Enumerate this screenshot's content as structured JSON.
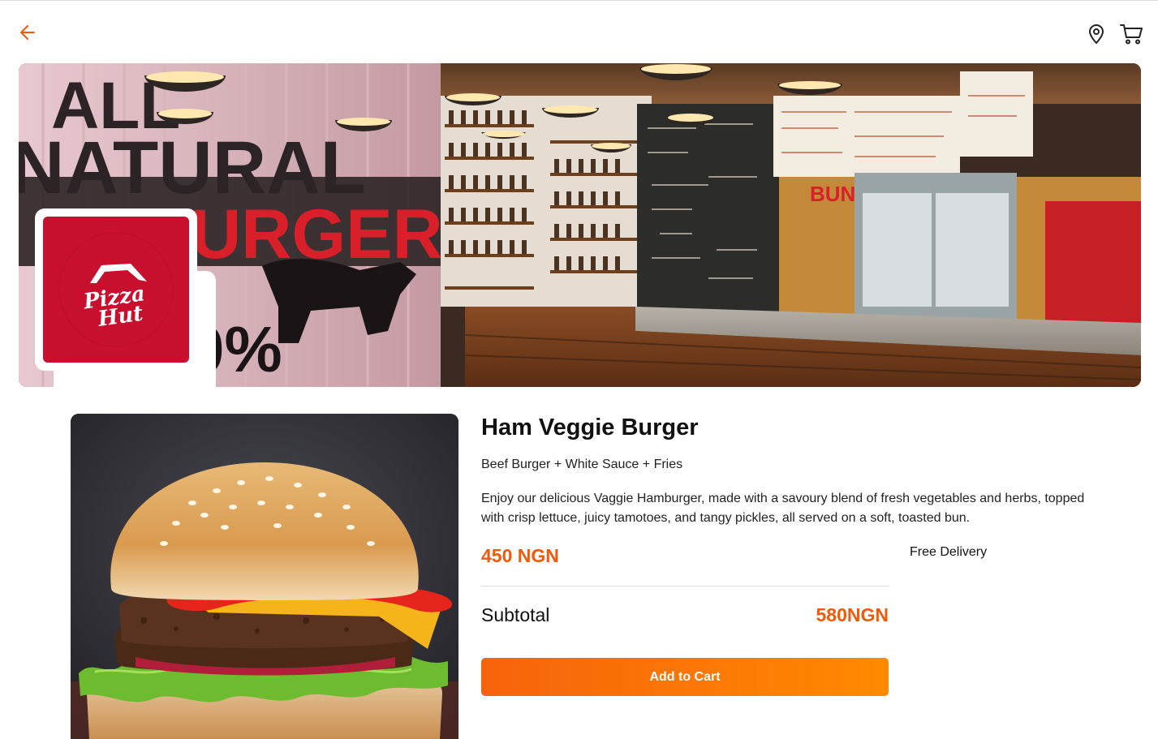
{
  "header": {
    "back_icon": "arrow-left-icon",
    "location_icon": "map-pin-icon",
    "cart_icon": "shopping-cart-icon",
    "accent_color": "#f05a0a"
  },
  "banner": {
    "image": "restaurant-interior-banner",
    "wall_text": [
      "ALL",
      "NATURAL",
      "BURGERS",
      "100%"
    ],
    "sign_text": "BUNS",
    "logo": {
      "brand": "Pizza Hut",
      "line1": "Pizza",
      "line2": "Hut",
      "color": "#c8102e"
    }
  },
  "product": {
    "image": "veggie-burger-photo",
    "title": "Ham Veggie Burger",
    "subtitle": "Beef Burger + White Sauce + Fries",
    "description": "Enjoy our delicious Vaggie Hamburger, made with a savoury blend of fresh vegetables and herbs, topped with crisp lettuce, juicy tamotoes, and tangy pickles, all served on a soft, toasted bun.",
    "price": "450 NGN",
    "delivery": "Free Delivery"
  },
  "order": {
    "subtotal_label": "Subtotal",
    "subtotal_value": "580NGN",
    "add_button_label": "Add to Cart",
    "button_color": "#f7630c"
  }
}
